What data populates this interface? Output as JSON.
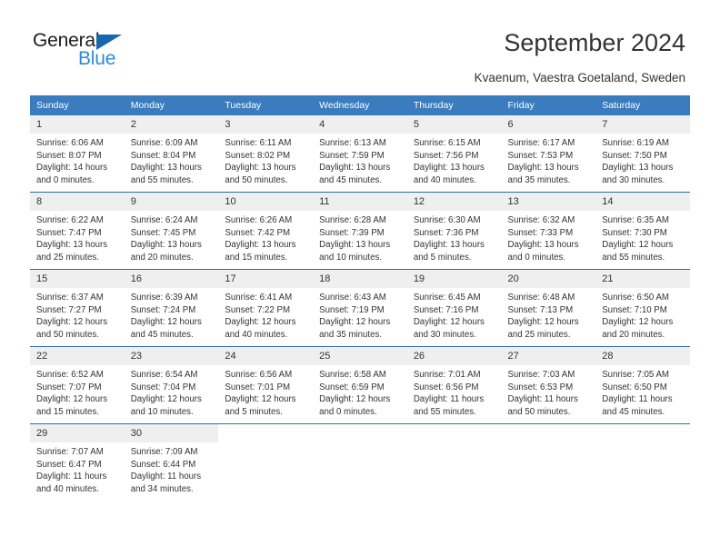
{
  "brand": {
    "name_part1": "General",
    "name_part2": "Blue"
  },
  "header": {
    "title": "September 2024",
    "subtitle": "Kvaenum, Vaestra Goetaland, Sweden"
  },
  "colors": {
    "header_blue": "#3a7cbe",
    "row_divider_blue": "#2a6ca8",
    "daynum_band": "#efefef",
    "brand_blue": "#2a8bd8",
    "text": "#333333"
  },
  "weekday_headers": [
    "Sunday",
    "Monday",
    "Tuesday",
    "Wednesday",
    "Thursday",
    "Friday",
    "Saturday"
  ],
  "weeks": [
    [
      {
        "day": "1",
        "sunrise": "Sunrise: 6:06 AM",
        "sunset": "Sunset: 8:07 PM",
        "daylight1": "Daylight: 14 hours",
        "daylight2": "and 0 minutes."
      },
      {
        "day": "2",
        "sunrise": "Sunrise: 6:09 AM",
        "sunset": "Sunset: 8:04 PM",
        "daylight1": "Daylight: 13 hours",
        "daylight2": "and 55 minutes."
      },
      {
        "day": "3",
        "sunrise": "Sunrise: 6:11 AM",
        "sunset": "Sunset: 8:02 PM",
        "daylight1": "Daylight: 13 hours",
        "daylight2": "and 50 minutes."
      },
      {
        "day": "4",
        "sunrise": "Sunrise: 6:13 AM",
        "sunset": "Sunset: 7:59 PM",
        "daylight1": "Daylight: 13 hours",
        "daylight2": "and 45 minutes."
      },
      {
        "day": "5",
        "sunrise": "Sunrise: 6:15 AM",
        "sunset": "Sunset: 7:56 PM",
        "daylight1": "Daylight: 13 hours",
        "daylight2": "and 40 minutes."
      },
      {
        "day": "6",
        "sunrise": "Sunrise: 6:17 AM",
        "sunset": "Sunset: 7:53 PM",
        "daylight1": "Daylight: 13 hours",
        "daylight2": "and 35 minutes."
      },
      {
        "day": "7",
        "sunrise": "Sunrise: 6:19 AM",
        "sunset": "Sunset: 7:50 PM",
        "daylight1": "Daylight: 13 hours",
        "daylight2": "and 30 minutes."
      }
    ],
    [
      {
        "day": "8",
        "sunrise": "Sunrise: 6:22 AM",
        "sunset": "Sunset: 7:47 PM",
        "daylight1": "Daylight: 13 hours",
        "daylight2": "and 25 minutes."
      },
      {
        "day": "9",
        "sunrise": "Sunrise: 6:24 AM",
        "sunset": "Sunset: 7:45 PM",
        "daylight1": "Daylight: 13 hours",
        "daylight2": "and 20 minutes."
      },
      {
        "day": "10",
        "sunrise": "Sunrise: 6:26 AM",
        "sunset": "Sunset: 7:42 PM",
        "daylight1": "Daylight: 13 hours",
        "daylight2": "and 15 minutes."
      },
      {
        "day": "11",
        "sunrise": "Sunrise: 6:28 AM",
        "sunset": "Sunset: 7:39 PM",
        "daylight1": "Daylight: 13 hours",
        "daylight2": "and 10 minutes."
      },
      {
        "day": "12",
        "sunrise": "Sunrise: 6:30 AM",
        "sunset": "Sunset: 7:36 PM",
        "daylight1": "Daylight: 13 hours",
        "daylight2": "and 5 minutes."
      },
      {
        "day": "13",
        "sunrise": "Sunrise: 6:32 AM",
        "sunset": "Sunset: 7:33 PM",
        "daylight1": "Daylight: 13 hours",
        "daylight2": "and 0 minutes."
      },
      {
        "day": "14",
        "sunrise": "Sunrise: 6:35 AM",
        "sunset": "Sunset: 7:30 PM",
        "daylight1": "Daylight: 12 hours",
        "daylight2": "and 55 minutes."
      }
    ],
    [
      {
        "day": "15",
        "sunrise": "Sunrise: 6:37 AM",
        "sunset": "Sunset: 7:27 PM",
        "daylight1": "Daylight: 12 hours",
        "daylight2": "and 50 minutes."
      },
      {
        "day": "16",
        "sunrise": "Sunrise: 6:39 AM",
        "sunset": "Sunset: 7:24 PM",
        "daylight1": "Daylight: 12 hours",
        "daylight2": "and 45 minutes."
      },
      {
        "day": "17",
        "sunrise": "Sunrise: 6:41 AM",
        "sunset": "Sunset: 7:22 PM",
        "daylight1": "Daylight: 12 hours",
        "daylight2": "and 40 minutes."
      },
      {
        "day": "18",
        "sunrise": "Sunrise: 6:43 AM",
        "sunset": "Sunset: 7:19 PM",
        "daylight1": "Daylight: 12 hours",
        "daylight2": "and 35 minutes."
      },
      {
        "day": "19",
        "sunrise": "Sunrise: 6:45 AM",
        "sunset": "Sunset: 7:16 PM",
        "daylight1": "Daylight: 12 hours",
        "daylight2": "and 30 minutes."
      },
      {
        "day": "20",
        "sunrise": "Sunrise: 6:48 AM",
        "sunset": "Sunset: 7:13 PM",
        "daylight1": "Daylight: 12 hours",
        "daylight2": "and 25 minutes."
      },
      {
        "day": "21",
        "sunrise": "Sunrise: 6:50 AM",
        "sunset": "Sunset: 7:10 PM",
        "daylight1": "Daylight: 12 hours",
        "daylight2": "and 20 minutes."
      }
    ],
    [
      {
        "day": "22",
        "sunrise": "Sunrise: 6:52 AM",
        "sunset": "Sunset: 7:07 PM",
        "daylight1": "Daylight: 12 hours",
        "daylight2": "and 15 minutes."
      },
      {
        "day": "23",
        "sunrise": "Sunrise: 6:54 AM",
        "sunset": "Sunset: 7:04 PM",
        "daylight1": "Daylight: 12 hours",
        "daylight2": "and 10 minutes."
      },
      {
        "day": "24",
        "sunrise": "Sunrise: 6:56 AM",
        "sunset": "Sunset: 7:01 PM",
        "daylight1": "Daylight: 12 hours",
        "daylight2": "and 5 minutes."
      },
      {
        "day": "25",
        "sunrise": "Sunrise: 6:58 AM",
        "sunset": "Sunset: 6:59 PM",
        "daylight1": "Daylight: 12 hours",
        "daylight2": "and 0 minutes."
      },
      {
        "day": "26",
        "sunrise": "Sunrise: 7:01 AM",
        "sunset": "Sunset: 6:56 PM",
        "daylight1": "Daylight: 11 hours",
        "daylight2": "and 55 minutes."
      },
      {
        "day": "27",
        "sunrise": "Sunrise: 7:03 AM",
        "sunset": "Sunset: 6:53 PM",
        "daylight1": "Daylight: 11 hours",
        "daylight2": "and 50 minutes."
      },
      {
        "day": "28",
        "sunrise": "Sunrise: 7:05 AM",
        "sunset": "Sunset: 6:50 PM",
        "daylight1": "Daylight: 11 hours",
        "daylight2": "and 45 minutes."
      }
    ],
    [
      {
        "day": "29",
        "sunrise": "Sunrise: 7:07 AM",
        "sunset": "Sunset: 6:47 PM",
        "daylight1": "Daylight: 11 hours",
        "daylight2": "and 40 minutes."
      },
      {
        "day": "30",
        "sunrise": "Sunrise: 7:09 AM",
        "sunset": "Sunset: 6:44 PM",
        "daylight1": "Daylight: 11 hours",
        "daylight2": "and 34 minutes."
      },
      {
        "day": "",
        "sunrise": "",
        "sunset": "",
        "daylight1": "",
        "daylight2": ""
      },
      {
        "day": "",
        "sunrise": "",
        "sunset": "",
        "daylight1": "",
        "daylight2": ""
      },
      {
        "day": "",
        "sunrise": "",
        "sunset": "",
        "daylight1": "",
        "daylight2": ""
      },
      {
        "day": "",
        "sunrise": "",
        "sunset": "",
        "daylight1": "",
        "daylight2": ""
      },
      {
        "day": "",
        "sunrise": "",
        "sunset": "",
        "daylight1": "",
        "daylight2": ""
      }
    ]
  ]
}
